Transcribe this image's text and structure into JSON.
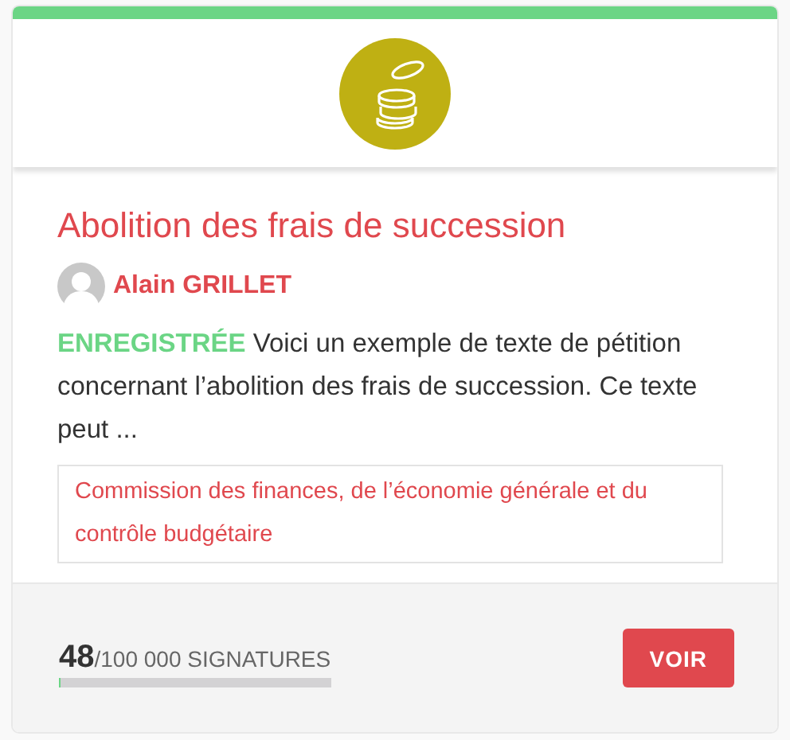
{
  "card": {
    "title": "Abolition des frais de succession",
    "author": {
      "name": "Alain GRILLET"
    },
    "status": "ENREGISTRÉE",
    "excerpt": "Voici un exemple de texte de pétition concernant l’abolition des frais de succession. Ce texte peut ...",
    "commission": "Commission des finances, de l’économie générale et du contrôle budgétaire",
    "signatures": {
      "count": "48",
      "goal": "/100 000 SIGNATURES",
      "level": 0.0005
    },
    "button": "VOIR"
  }
}
